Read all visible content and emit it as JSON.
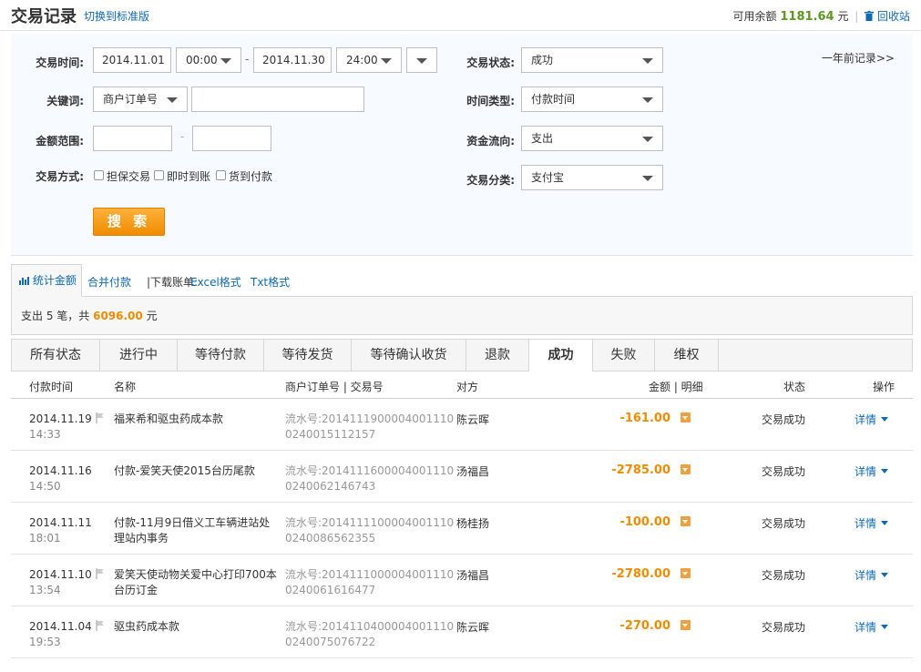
{
  "header": {
    "title": "交易记录",
    "switch_link": "切换到标准版",
    "balance_label": "可用余额",
    "balance_amount": "1181.64",
    "balance_unit": "元",
    "sep": "|",
    "recycle_label": "回收站"
  },
  "filter": {
    "time_label": "交易时间:",
    "start_date": "2014.11.01",
    "start_time": "00:00",
    "dash": "-",
    "end_date": "2014.11.30",
    "end_time": "24:00",
    "status_label": "交易状态:",
    "status_value": "成功",
    "old_records": "一年前记录>>",
    "keyword_label": "关键词:",
    "keyword_type": "商户订单号",
    "keyword_value": "",
    "time_type_label": "时间类型:",
    "time_type_value": "付款时间",
    "amount_label": "金额范围:",
    "amount_min": "",
    "amount_max": "",
    "flow_label": "资金流向:",
    "flow_value": "支出",
    "method_label": "交易方式:",
    "methods": [
      "担保交易",
      "即时到账",
      "货到付款"
    ],
    "category_label": "交易分类:",
    "category_value": "支付宝",
    "search_button": "搜 索"
  },
  "stat_tabs": {
    "stat_amount": "统计金额",
    "merge_pay": "合并付款",
    "download_label": "|下载账单:",
    "excel": "Excel格式",
    "txt": "Txt格式"
  },
  "summary": {
    "prefix": "支出 5 笔，共",
    "amount": "6096.00",
    "unit": "元"
  },
  "status_tabs": [
    "所有状态",
    "进行中",
    "等待付款",
    "等待发货",
    "等待确认收货",
    "退款",
    "成功",
    "失败",
    "维权"
  ],
  "active_status_tab": "成功",
  "table": {
    "columns": {
      "pay_time": "付款时间",
      "name": "名称",
      "order_no": "商户订单号 | 交易号",
      "party": "对方",
      "amount": "金额 | 明细",
      "status": "状态",
      "action": "操作"
    },
    "rows": [
      {
        "date": "2014.11.19",
        "time": "14:33",
        "name": "福来希和驱虫药成本款",
        "serial": "流水号:20141119000040011100240015112157",
        "party": "陈云晖",
        "amount": "-161.00",
        "status": "交易成功",
        "details": "详情"
      },
      {
        "date": "2014.11.16",
        "time": "14:50",
        "name": "付款-爱笑天使2015台历尾款",
        "serial": "流水号:20141116000040011100240062146743",
        "party": "汤福昌",
        "amount": "-2785.00",
        "status": "交易成功",
        "details": "详情"
      },
      {
        "date": "2014.11.11",
        "time": "18:01",
        "name": "付款-11月9日借义工车辆进站处理站内事务",
        "serial": "流水号:20141111000040011100240086562355",
        "party": "杨桂扬",
        "amount": "-100.00",
        "status": "交易成功",
        "details": "详情"
      },
      {
        "date": "2014.11.10",
        "time": "13:54",
        "name": "爱笑天使动物关爱中心打印700本台历订金",
        "serial": "流水号:20141110000040011100240061616477",
        "party": "汤福昌",
        "amount": "-2780.00",
        "status": "交易成功",
        "details": "详情"
      },
      {
        "date": "2014.11.04",
        "time": "19:53",
        "name": "驱虫药成本款",
        "serial": "流水号:20141104000040011100240075076722",
        "party": "陈云晖",
        "amount": "-270.00",
        "status": "交易成功",
        "details": "详情"
      }
    ]
  },
  "colors": {
    "link": "#0f6ab4",
    "amount": "#f08c00",
    "balance": "#5a9a1d",
    "search_button": "#f5a020"
  }
}
